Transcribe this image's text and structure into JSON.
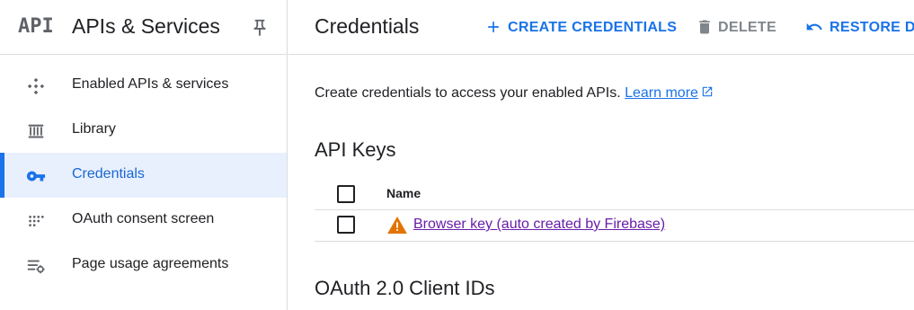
{
  "sidebar": {
    "logo": "API",
    "title": "APIs & Services",
    "items": [
      {
        "label": "Enabled APIs & services",
        "icon": "enabled-apis-icon"
      },
      {
        "label": "Library",
        "icon": "library-icon"
      },
      {
        "label": "Credentials",
        "icon": "key-icon",
        "active": true
      },
      {
        "label": "OAuth consent screen",
        "icon": "oauth-consent-icon"
      },
      {
        "label": "Page usage agreements",
        "icon": "page-usage-icon"
      }
    ]
  },
  "topbar": {
    "title": "Credentials",
    "create_label": "CREATE CREDENTIALS",
    "delete_label": "DELETE",
    "restore_label": "RESTORE DE"
  },
  "main": {
    "intro_text": "Create credentials to access your enabled APIs.",
    "learn_more": "Learn more",
    "api_keys_title": "API Keys",
    "table_header_name": "Name",
    "api_keys": [
      {
        "name": "Browser key (auto created by Firebase)",
        "status_icon": "warning-icon"
      }
    ],
    "oauth_title": "OAuth 2.0 Client IDs"
  },
  "colors": {
    "accent": "#1a73e8",
    "active_bg": "#e8f0fe",
    "visited_link": "#681da8",
    "warning": "#e37400",
    "disabled": "#80868b",
    "divider": "#dadce0"
  }
}
